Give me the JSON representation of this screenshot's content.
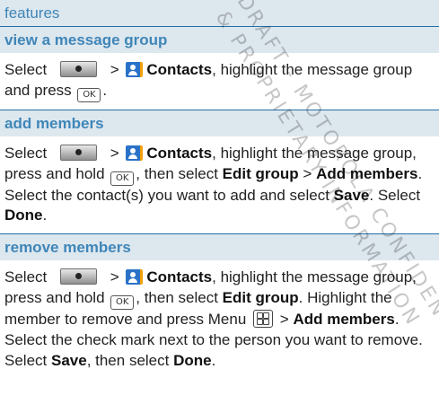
{
  "header": {
    "title": "features"
  },
  "sections": [
    {
      "heading": "view a message group",
      "parts": [
        "Select",
        ">",
        "Contacts",
        ", highlight the message group and press",
        "."
      ]
    },
    {
      "heading": "add members",
      "parts": [
        "Select",
        ">",
        "Contacts",
        ", highlight the message group, press and hold",
        ", then select",
        "Edit group",
        ">",
        "Add members",
        ". Select the contact(s) you want to add and select",
        "Save",
        ". Select",
        "Done",
        "."
      ]
    },
    {
      "heading": "remove members",
      "parts": [
        "Select",
        ">",
        "Contacts",
        ", highlight the message group, press and hold",
        ", then select",
        "Edit group",
        ". Highlight the member to remove and press Menu",
        ">",
        "Add members",
        ". Select the check mark next to the person you want to remove. Select",
        "Save",
        ", then select",
        "Done",
        "."
      ]
    }
  ],
  "keys": {
    "ok": "OK"
  },
  "watermark": {
    "line1": "DRAFT - MOTOROLA CONFIDENTIAL",
    "line2": "& PROPRIETARY INFORMATION"
  },
  "icons": [
    "home-key-icon",
    "contacts-app-icon",
    "ok-key-icon",
    "menu-key-icon"
  ]
}
